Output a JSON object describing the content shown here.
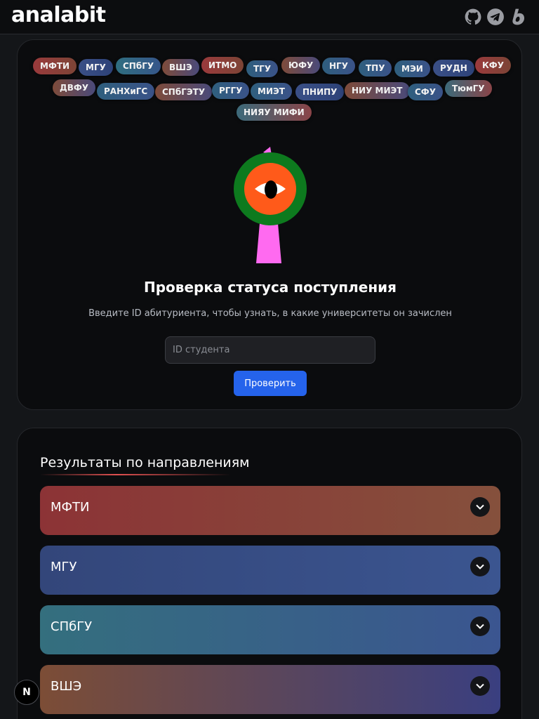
{
  "header": {
    "logo": "analabit",
    "icons": [
      "github-icon",
      "telegram-icon",
      "boosty-icon"
    ]
  },
  "universities": [
    "МФТИ",
    "МГУ",
    "СПбГУ",
    "ВШЭ",
    "ИТМО",
    "ТГУ",
    "ЮФУ",
    "НГУ",
    "ТПУ",
    "МЭИ",
    "РУДН",
    "КФУ",
    "ДВФУ",
    "РАНХиГС",
    "СПбГЭТУ",
    "РГГУ",
    "МИЭТ",
    "ПНИПУ",
    "НИУ МИЭТ",
    "СФУ",
    "ТюмГУ",
    "НИЯУ МИФИ"
  ],
  "hero": {
    "title": "Проверка статуса поступления",
    "subtitle": "Введите ID абитуриента, чтобы узнать, в какие университеты он зачислен",
    "input_placeholder": "ID студента",
    "button": "Проверить"
  },
  "results": {
    "title": "Результаты по направлениям",
    "items": [
      "МФТИ",
      "МГУ",
      "СПбГУ",
      "ВШЭ"
    ]
  },
  "badge": "N",
  "colors": {
    "button": "#2563eb",
    "eye_outer": "#0d7a1e",
    "eye_iris": "#ff5a1a",
    "eye_stalk": "#ff6af0"
  }
}
